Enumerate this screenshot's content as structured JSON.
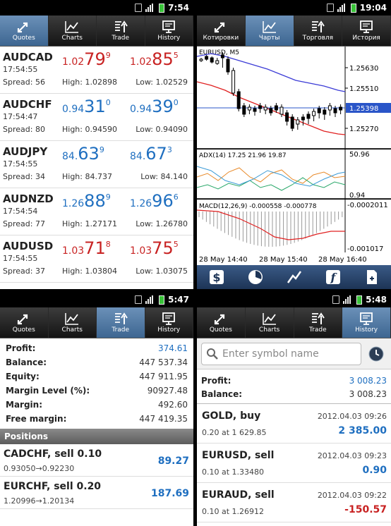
{
  "quotes_panel": {
    "time": "7:54",
    "tabs": [
      "Quotes",
      "Charts",
      "Trade",
      "History"
    ],
    "rows": [
      {
        "symbol": "AUDCAD",
        "time": "17:54:55",
        "spread": "Spread: 56",
        "high": "High: 1.02898",
        "low": "Low: 1.02529",
        "dir": "down",
        "bid": {
          "s": "1.02",
          "b": "79",
          "p": "9"
        },
        "ask": {
          "s": "1.02",
          "b": "85",
          "p": "5"
        }
      },
      {
        "symbol": "AUDCHF",
        "time": "17:54:47",
        "spread": "Spread: 80",
        "high": "High: 0.94590",
        "low": "Low: 0.94090",
        "dir": "up",
        "bid": {
          "s": "0.94",
          "b": "31",
          "p": "0"
        },
        "ask": {
          "s": "0.94",
          "b": "39",
          "p": "0"
        }
      },
      {
        "symbol": "AUDJPY",
        "time": "17:54:55",
        "spread": "Spread: 34",
        "high": "High: 84.737",
        "low": "Low: 84.140",
        "dir": "up",
        "bid": {
          "s": "84.",
          "b": "63",
          "p": "9"
        },
        "ask": {
          "s": "84.",
          "b": "67",
          "p": "3"
        }
      },
      {
        "symbol": "AUDNZD",
        "time": "17:54:54",
        "spread": "Spread: 77",
        "high": "High: 1.27171",
        "low": "Low: 1.26780",
        "dir": "up",
        "bid": {
          "s": "1.26",
          "b": "88",
          "p": "9"
        },
        "ask": {
          "s": "1.26",
          "b": "96",
          "p": "6"
        }
      },
      {
        "symbol": "AUDUSD",
        "time": "17:54:55",
        "spread": "Spread: 37",
        "high": "High: 1.03804",
        "low": "Low: 1.03075",
        "dir": "down",
        "bid": {
          "s": "1.03",
          "b": "71",
          "p": "8"
        },
        "ask": {
          "s": "1.03",
          "b": "75",
          "p": "5"
        }
      }
    ]
  },
  "charts_panel": {
    "time": "19:04",
    "tabs": [
      "Котировки",
      "Чарты",
      "Торговля",
      "История"
    ],
    "symbol_label": "EURUSD, M5",
    "price_levels": [
      "1.25630",
      "1.25510",
      "1.25398",
      "1.25270"
    ],
    "adx_label": "ADX(14) 17.25 21.96 19.87",
    "adx_levels": [
      "50.96",
      "0.94"
    ],
    "macd_label": "MACD(12,26,9) -0.000558 -0.000778",
    "macd_levels": [
      "-0.0002011",
      "-0.001017"
    ],
    "time_labels": [
      "28 May 14:40",
      "28 May 15:40",
      "28 May 16:40"
    ],
    "toolbar": [
      "$",
      "◔",
      "∕",
      "f",
      "+"
    ],
    "colors": {
      "ma_blue": "#3b3bd6",
      "ma_red": "#e02020",
      "current_price_line": "#2a55c8"
    }
  },
  "trade_panel": {
    "time": "5:47",
    "tabs": [
      "Quotes",
      "Charts",
      "Trade",
      "History"
    ],
    "summary": [
      {
        "label": "Profit:",
        "value": "374.61",
        "blue": true
      },
      {
        "label": "Balance:",
        "value": "447 537.34"
      },
      {
        "label": "Equity:",
        "value": "447 911.95"
      },
      {
        "label": "Margin Level (%):",
        "value": "90927.48"
      },
      {
        "label": "Margin:",
        "value": "492.60"
      },
      {
        "label": "Free margin:",
        "value": "447 419.35"
      }
    ],
    "positions_header": "Positions",
    "positions": [
      {
        "title": "CADCHF, sell 0.10",
        "prices": "0.93050→0.92230",
        "profit": "89.27"
      },
      {
        "title": "EURCHF, sell 0.20",
        "prices": "1.20996→1.20134",
        "profit": "187.69"
      }
    ]
  },
  "history_panel": {
    "time": "5:48",
    "tabs": [
      "Quotes",
      "Charts",
      "Trade",
      "History"
    ],
    "search_placeholder": "Enter symbol name",
    "summary": [
      {
        "label": "Profit:",
        "value": "3 008.23"
      },
      {
        "label": "Balance:",
        "value": "3 008.23"
      }
    ],
    "deals": [
      {
        "title": "GOLD, buy",
        "time": "2012.04.03 09:26",
        "detail": "0.20 at 1 629.85",
        "profit": "2 385.00",
        "negative": false
      },
      {
        "title": "EURUSD, sell",
        "time": "2012.04.03 09:23",
        "detail": "0.10 at 1.33480",
        "profit": "0.90",
        "negative": false
      },
      {
        "title": "EURAUD, sell",
        "time": "2012.04.03 09:22",
        "detail": "0.10 at 1.26912",
        "profit": "-150.57",
        "negative": true
      }
    ]
  }
}
